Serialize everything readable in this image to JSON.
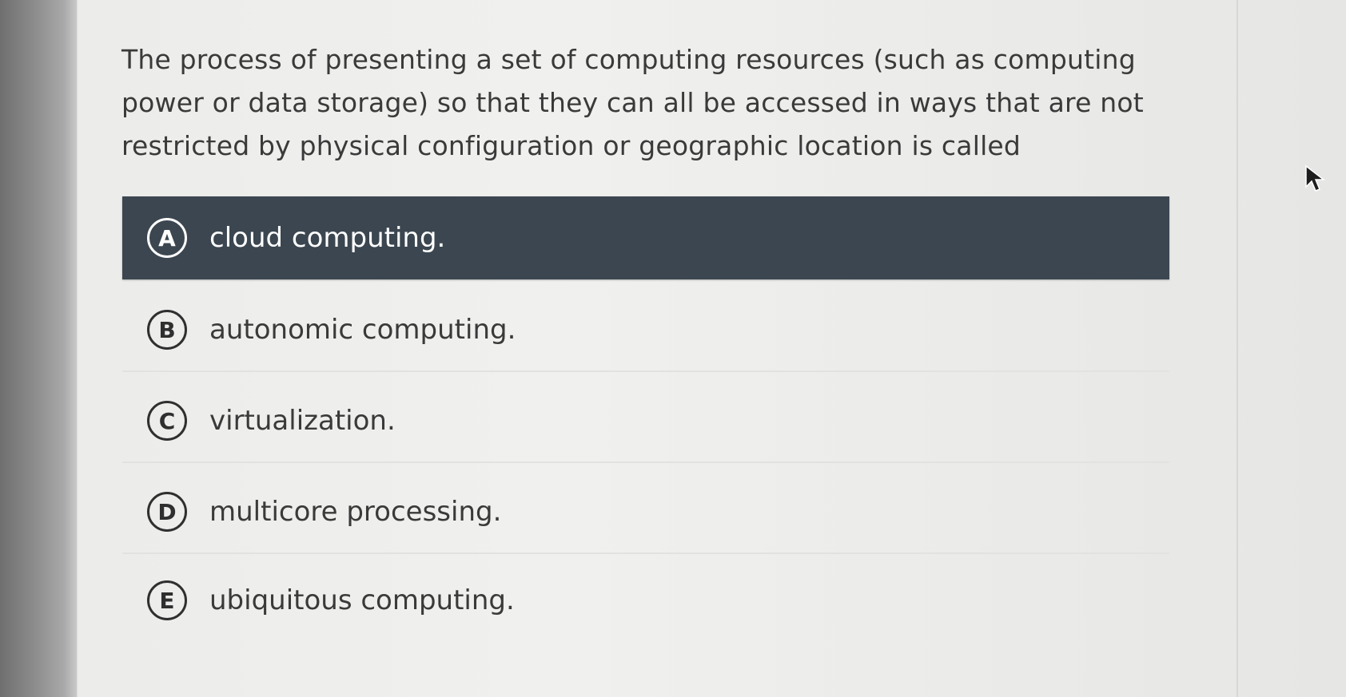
{
  "question": {
    "text": "The process of presenting a set of computing resources (such as computing power or data storage) so that they can all be accessed in ways that are not restricted by physical configuration or geographic location is called"
  },
  "options": [
    {
      "letter": "A",
      "text": "cloud computing.",
      "selected": true
    },
    {
      "letter": "B",
      "text": "autonomic computing.",
      "selected": false
    },
    {
      "letter": "C",
      "text": "virtualization.",
      "selected": false
    },
    {
      "letter": "D",
      "text": "multicore processing.",
      "selected": false
    },
    {
      "letter": "E",
      "text": "ubiquitous computing.",
      "selected": false
    }
  ],
  "colors": {
    "selected_bg": "#3b4650",
    "text": "#3a3a3a",
    "page_bg": "#f0f0ee"
  },
  "icons": {
    "cursor": "mouse-pointer-icon"
  }
}
